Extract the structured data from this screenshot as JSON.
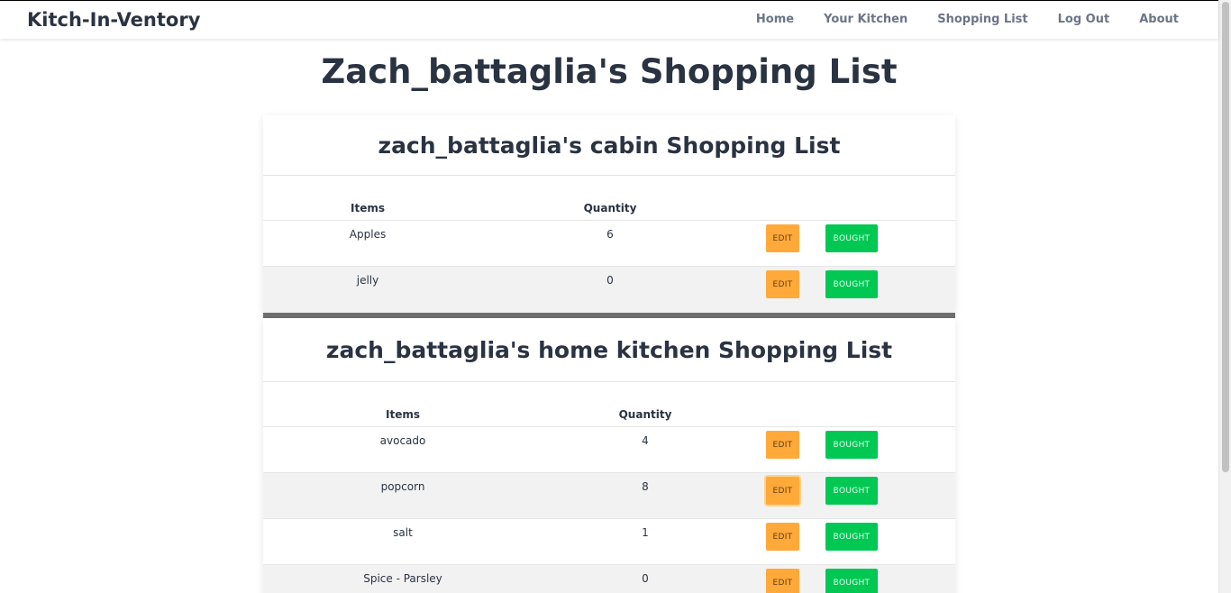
{
  "nav": {
    "brand": "Kitch-In-Ventory",
    "links": [
      "Home",
      "Your Kitchen",
      "Shopping List",
      "Log Out",
      "About"
    ]
  },
  "page": {
    "title": "Zach_battaglia's Shopping List"
  },
  "table": {
    "items_header": "Items",
    "quantity_header": "Quantity",
    "edit_label": "EDIT",
    "bought_label": "BOUGHT"
  },
  "lists": [
    {
      "title": "zach_battaglia's cabin Shopping List",
      "rows": [
        {
          "item": "Apples",
          "quantity": "6"
        },
        {
          "item": "jelly",
          "quantity": "0"
        }
      ]
    },
    {
      "title": "zach_battaglia's home kitchen Shopping List",
      "rows": [
        {
          "item": "avocado",
          "quantity": "4"
        },
        {
          "item": "popcorn",
          "quantity": "8"
        },
        {
          "item": "salt",
          "quantity": "1"
        },
        {
          "item": "Spice - Parsley",
          "quantity": "0"
        }
      ]
    }
  ],
  "colors": {
    "edit": "#ffa93a",
    "bought": "#00c853",
    "text": "#2a3342",
    "nav_text": "#6b7587"
  }
}
